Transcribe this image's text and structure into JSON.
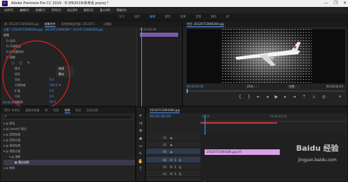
{
  "window": {
    "title": "Adobe Premiere Pro CC 2019 - E:\\PR2019\\未命名.prproj *",
    "controls": [
      "—",
      "❐",
      "✕"
    ]
  },
  "menu": [
    "文件(F)",
    "编辑(E)",
    "剪辑(C)",
    "序列(S)",
    "标记(M)",
    "图形(G)",
    "窗口(W)",
    "帮助(H)"
  ],
  "workspaces": [
    "学习",
    "组件",
    "编辑",
    "颜色",
    "效果",
    "音频",
    "图形",
    "库"
  ],
  "effect_controls": {
    "tabs": [
      "源: 20120713094284.jpg",
      "效果控件",
      "音频剪辑混合器: 2012071...",
      "元数据"
    ],
    "source_path": "主要 * 20120713094284.jpg  ·  20120713094284 * 20120713094284.jpg",
    "sections": [
      "视频",
      "运动",
      "不透明度",
      "时间重映射",
      "模糊"
    ],
    "rows": [
      {
        "label": "蒙版",
        "value": ""
      },
      {
        "label": "模式",
        "value": "普通"
      },
      {
        "label": "混合",
        "value": "叠加"
      },
      {
        "label": "羽化",
        "value": "0.0"
      },
      {
        "label": "不透明度",
        "value": "100.0 %"
      },
      {
        "label": "扩展",
        "value": "0.0"
      },
      {
        "label": "方向",
        "value": "0.0"
      },
      {
        "label": "对比度",
        "value": "50.0"
      },
      {
        "label": "细节",
        "value": "100.0"
      },
      {
        "label": "锐化",
        "value": "0.0"
      },
      {
        "label": "边缘阈值",
        "value": "0.0"
      },
      {
        "label": "混合模式",
        "value": ""
      }
    ],
    "timecode": "00:00:00:00"
  },
  "program": {
    "tab": "节目: 20120713094284.jpg",
    "timecode": "00:00:00:00",
    "zoom": "25%",
    "quality": "完整",
    "end_time": "00:00:04:24"
  },
  "project": {
    "tabs": [
      "项目: 未命名",
      "媒体浏览器",
      "库",
      "信息",
      "效果",
      "标记",
      "历史记录"
    ],
    "search_placeholder": "",
    "folders": [
      "预设",
      "Lumetri 预设",
      "音频效果",
      "音频过渡",
      "视频效果",
      "视频过渡",
      "溶解",
      "擦除",
      "缩放",
      "页面剥落"
    ],
    "selected_item": "叠加溶解"
  },
  "timeline": {
    "tab": "20120713094284.jpg",
    "timecode": "00:00:00:00",
    "ruler": [
      "00:00",
      "00:00:05:00"
    ],
    "tracks": [
      "V3",
      "V2",
      "V1",
      "A1",
      "A2",
      "A3"
    ],
    "clip_label": "20120713094284.jpg [V]"
  },
  "watermark": {
    "text": "Baidu 经验",
    "url": "jingyan.baidu.com"
  },
  "colors": {
    "accent": "#4b9cff",
    "clip": "#d9a2e6",
    "playhead": "#4b9cff",
    "annotation": "#d01b1b"
  }
}
